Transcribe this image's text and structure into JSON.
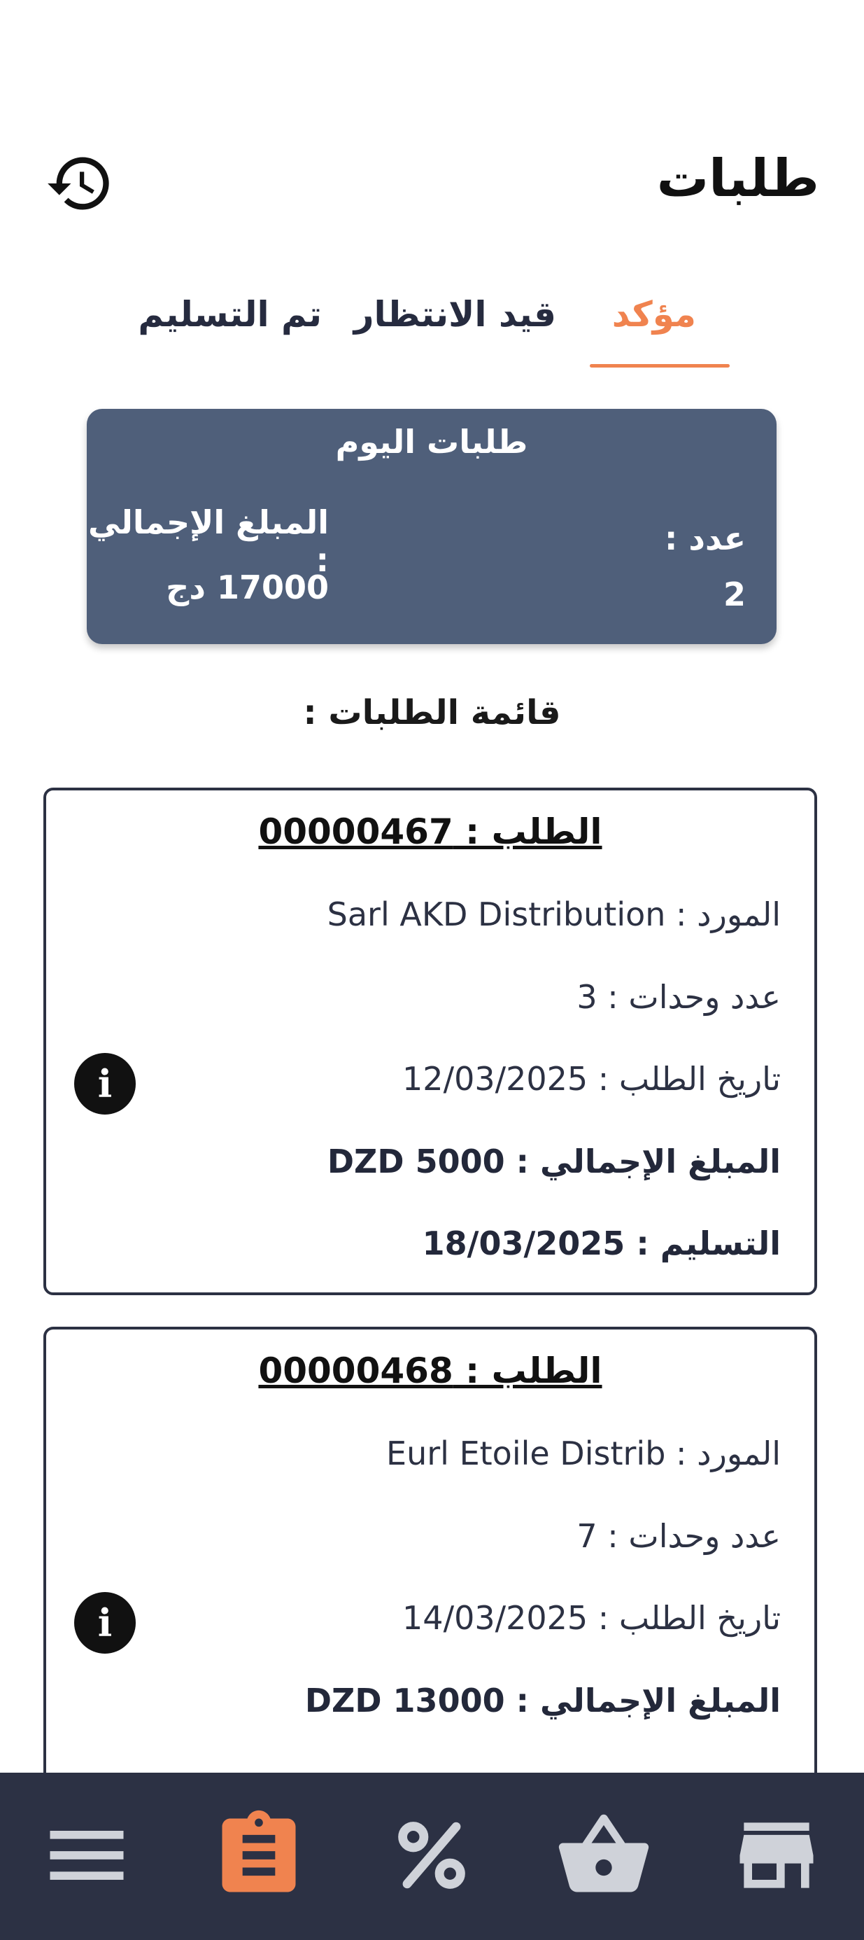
{
  "header": {
    "title": "طلبات",
    "history_icon": "history-icon"
  },
  "tabs": [
    {
      "label": "مؤكد",
      "active": true
    },
    {
      "label": "قيد الانتظار",
      "active": false
    },
    {
      "label": "تم التسليم",
      "active": false
    }
  ],
  "summary": {
    "title": "طلبات اليوم",
    "count_label": "عدد :",
    "count_value": "2",
    "total_label": "المبلغ الإجمالي :",
    "total_value": "17000 دج"
  },
  "list_heading": "قائمة الطلبات :",
  "orders": [
    {
      "title": "الطلب : 00000467",
      "supplier": "المورد : Sarl AKD Distribution",
      "units": "عدد وحدات : 3",
      "order_date": "تاريخ الطلب : 12/03/2025",
      "total": "المبلغ الإجمالي : DZD 5000",
      "delivery": "التسليم : 18/03/2025"
    },
    {
      "title": "الطلب : 00000468",
      "supplier": "المورد : Eurl Etoile Distrib",
      "units": "عدد وحدات : 7",
      "order_date": "تاريخ الطلب : 14/03/2025",
      "total": "المبلغ الإجمالي : DZD 13000"
    }
  ],
  "bottom_nav": [
    {
      "icon": "menu-icon",
      "active": false
    },
    {
      "icon": "clipboard-icon",
      "active": true
    },
    {
      "icon": "percent-icon",
      "active": false
    },
    {
      "icon": "basket-icon",
      "active": false
    },
    {
      "icon": "store-icon",
      "active": false
    }
  ],
  "colors": {
    "accent": "#f0834f",
    "dark": "#2c3144",
    "card": "#4f5f7a",
    "nav_inactive": "#cfd2d9"
  }
}
